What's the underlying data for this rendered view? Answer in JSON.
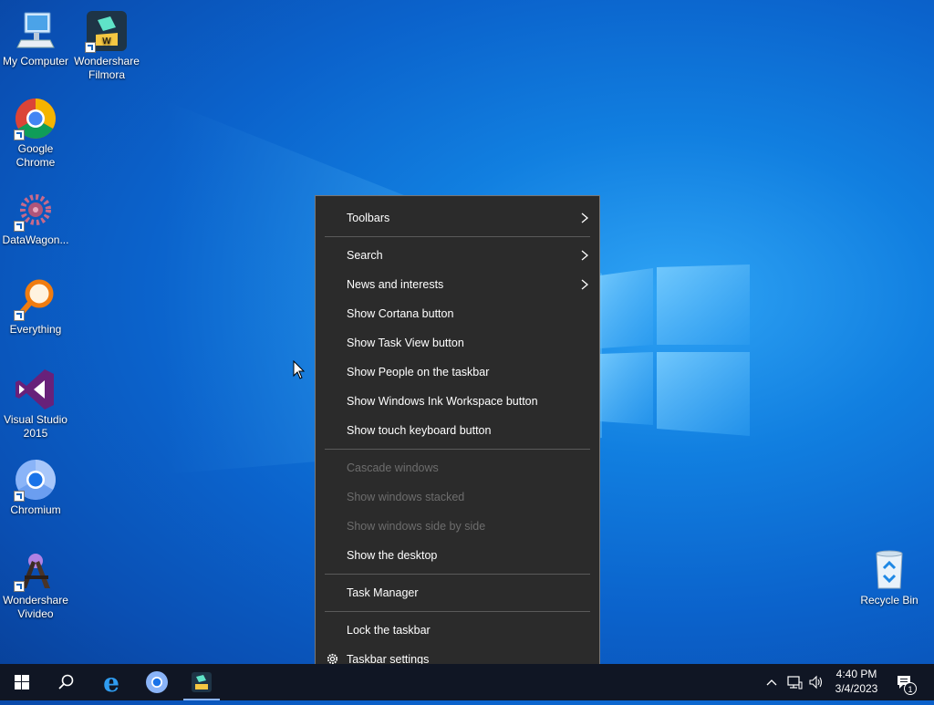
{
  "desktop": {
    "icons": [
      {
        "label": "My Computer",
        "icon": "computer-icon"
      },
      {
        "label": "Wondershare Filmora",
        "icon": "filmora-icon"
      },
      {
        "label": "Google Chrome",
        "icon": "chrome-icon"
      },
      {
        "label": "DataWagon...",
        "icon": "datawagon-icon"
      },
      {
        "label": "Everything",
        "icon": "everything-search-icon"
      },
      {
        "label": "Visual Studio 2015",
        "icon": "visual-studio-icon"
      },
      {
        "label": "Chromium",
        "icon": "chromium-icon"
      },
      {
        "label": "Wondershare Vivideo",
        "icon": "vivideo-icon"
      },
      {
        "label": "Recycle Bin",
        "icon": "recycle-bin-icon"
      }
    ]
  },
  "context_menu": {
    "items": [
      {
        "label": "Toolbars",
        "submenu": true
      },
      {
        "label": "Search",
        "submenu": true
      },
      {
        "label": "News and interests",
        "submenu": true
      },
      {
        "label": "Show Cortana button"
      },
      {
        "label": "Show Task View button"
      },
      {
        "label": "Show People on the taskbar"
      },
      {
        "label": "Show Windows Ink Workspace button"
      },
      {
        "label": "Show touch keyboard button"
      },
      {
        "label": "Cascade windows",
        "disabled": true
      },
      {
        "label": "Show windows stacked",
        "disabled": true
      },
      {
        "label": "Show windows side by side",
        "disabled": true
      },
      {
        "label": "Show the desktop"
      },
      {
        "label": "Task Manager"
      },
      {
        "label": "Lock the taskbar"
      },
      {
        "label": "Taskbar settings",
        "icon": "gear-icon"
      }
    ]
  },
  "taskbar": {
    "buttons": [
      "start-icon",
      "search-icon",
      "edge-icon",
      "chromium-icon",
      "filmora-icon"
    ],
    "tray": {
      "time": "4:40 PM",
      "date": "3/4/2023",
      "notification_count": "1"
    }
  },
  "colors": {
    "menu_bg": "#2b2b2b",
    "taskbar_bg": "#101624",
    "disabled_text": "#6d6d6d"
  }
}
